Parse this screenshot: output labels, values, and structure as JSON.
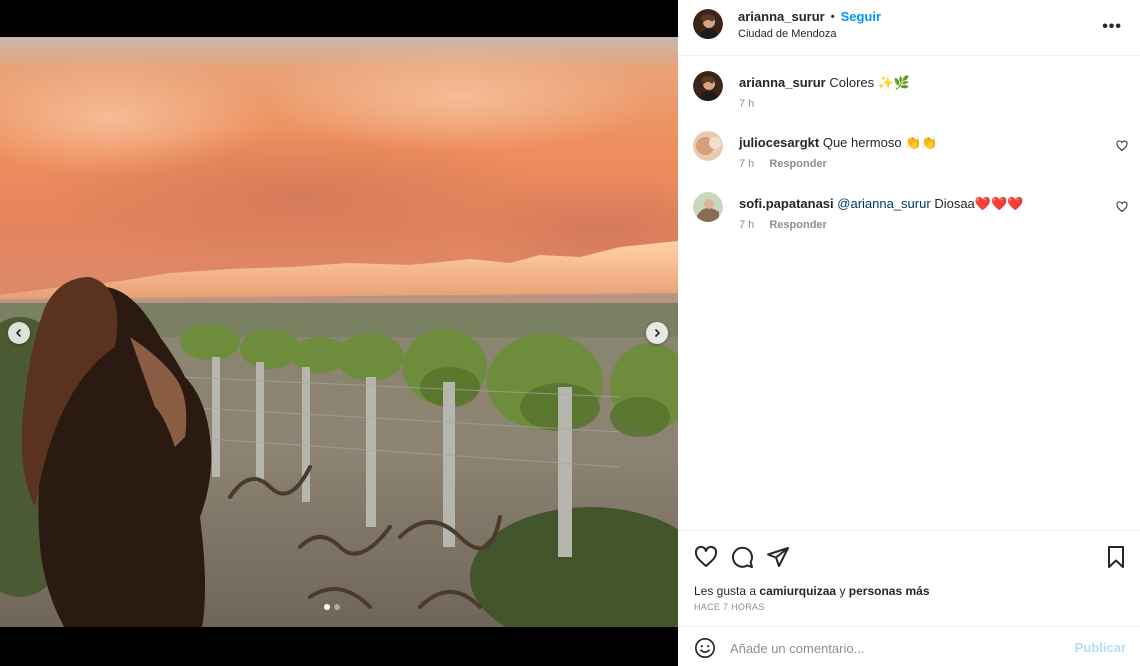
{
  "post": {
    "username": "arianna_surur",
    "separator": "•",
    "follow_label": "Seguir",
    "location": "Ciudad de Mendoza",
    "more_label": "•••",
    "image_alt": "Woman looking at vineyard and mountains at sunset",
    "carousel": {
      "total": 2,
      "active": 1
    }
  },
  "caption": {
    "username": "arianna_surur",
    "text": "Colores",
    "emoji": "✨🌿",
    "time": "7 h"
  },
  "comments": [
    {
      "username": "juliocesargkt",
      "text": "Que hermoso",
      "emoji": "👏👏",
      "time": "7 h",
      "reply_label": "Responder"
    },
    {
      "username": "sofi.papatanasi",
      "mention": "@arianna_surur",
      "text": "Diosaa",
      "emoji": "❤️❤️❤️",
      "time": "7 h",
      "reply_label": "Responder"
    }
  ],
  "likes": {
    "prefix": "Les gusta a",
    "user": "camiurquizaa",
    "connector": "y",
    "others": "personas más"
  },
  "timeago": "HACE 7 HORAS",
  "add_comment": {
    "placeholder": "Añade un comentario...",
    "publish_label": "Publicar"
  },
  "colors": {
    "accent": "#0095f6",
    "publish_disabled": "#b2dffc",
    "mention": "#00376b",
    "secondary_text": "#8e8e8e"
  },
  "icons": [
    "heart-icon",
    "comment-icon",
    "share-icon",
    "bookmark-icon",
    "smiley-icon",
    "chevron-left-icon",
    "chevron-right-icon",
    "more-icon"
  ]
}
